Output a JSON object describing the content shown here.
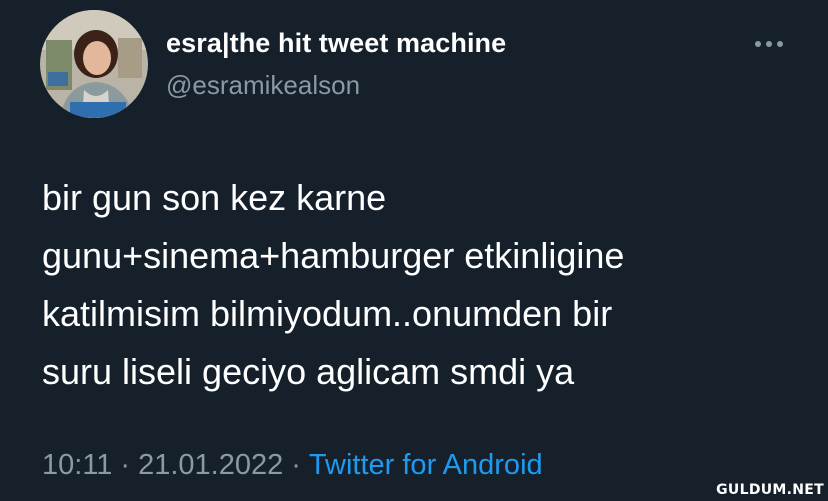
{
  "tweet": {
    "display_name": "esra|the hit tweet machine",
    "handle": "@esramikealson",
    "more_icon": "more-horizontal-icon",
    "text_lines": [
      "bir gun son kez karne",
      "gunu+sinema+hamburger etkinligine",
      "katilmisim bilmiyodum..onumden bir",
      "suru liseli geciyo aglicam smdi ya"
    ],
    "time": "10:11",
    "separator": "·",
    "date": "21.01.2022",
    "source": "Twitter for Android"
  },
  "watermark": "GULDUM.NET",
  "colors": {
    "background": "#15202b",
    "primary_text": "#ffffff",
    "secondary_text": "#8b98a5",
    "link": "#1d9bf0"
  }
}
